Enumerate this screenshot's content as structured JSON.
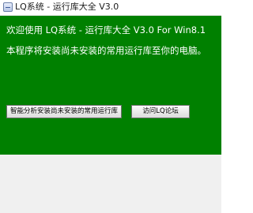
{
  "window": {
    "title": "LQ系统 - 运行库大全 V3.0"
  },
  "content": {
    "welcome_text": "欢迎使用 LQ系统 - 运行库大全 V3.0 For Win8.1",
    "description": "本程序将安装尚未安装的常用运行库至你的电脑。"
  },
  "buttons": {
    "analyze_install": "智能分析安装尚未安装的常用运行库",
    "visit_forum": "访问LQ论坛"
  },
  "colors": {
    "content_background": "#008000",
    "content_text": "#ffffff"
  },
  "icons": {
    "app": "app-icon"
  }
}
